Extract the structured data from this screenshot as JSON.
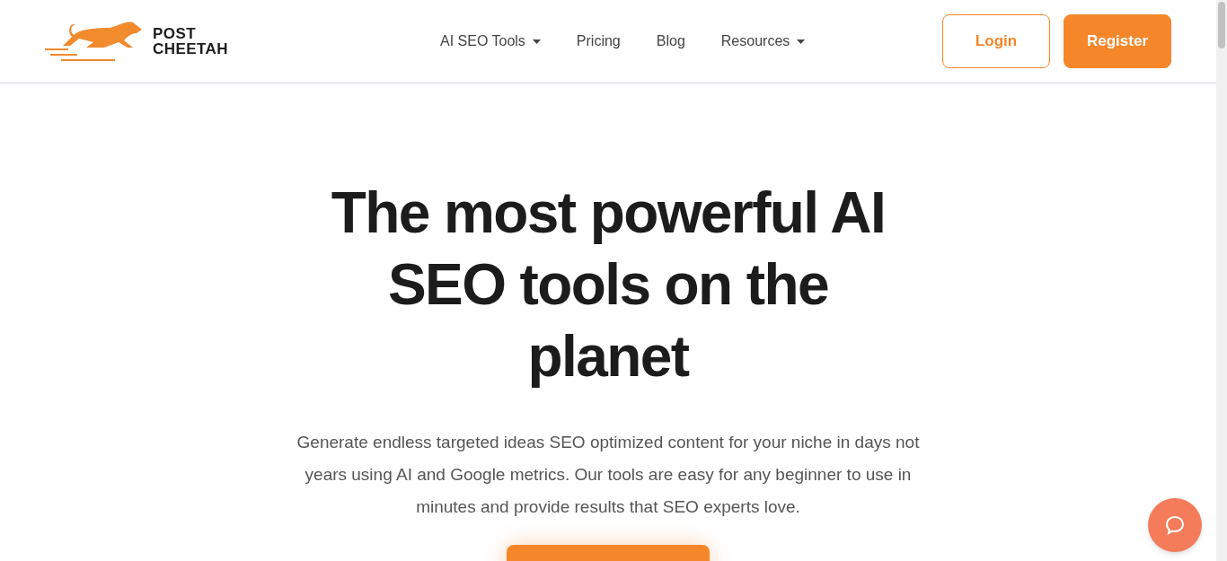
{
  "logo": {
    "lines": [
      "POST",
      "CHEETAH"
    ]
  },
  "nav": [
    {
      "label": "AI SEO Tools",
      "has_menu": true
    },
    {
      "label": "Pricing",
      "has_menu": false
    },
    {
      "label": "Blog",
      "has_menu": false
    },
    {
      "label": "Resources",
      "has_menu": true
    }
  ],
  "auth_buttons": [
    {
      "label": "Login",
      "kind": "outline"
    },
    {
      "label": "Register",
      "kind": "solid"
    }
  ],
  "hero": {
    "headline": "The most powerful AI SEO tools on the planet",
    "description": "Generate endless targeted ideas SEO optimized content for your niche in days not years using AI and Google metrics. Our tools are easy for any beginner to use in minutes and provide results that SEO experts love."
  }
}
